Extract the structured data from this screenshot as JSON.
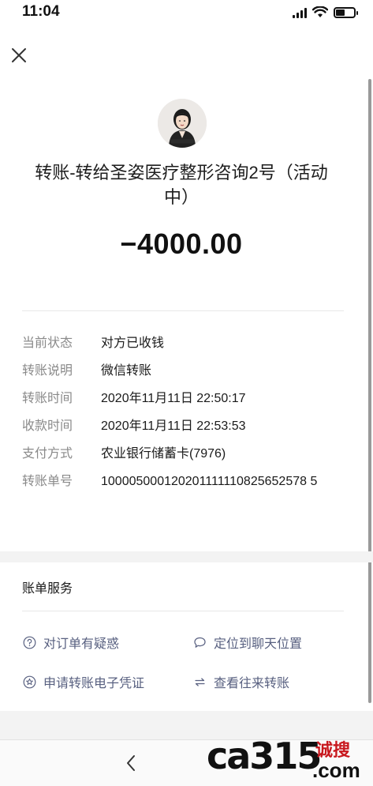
{
  "status_bar": {
    "time": "11:04"
  },
  "transfer": {
    "title": "转账-转给圣姿医疗整形咨询2号（活动中）",
    "amount": "−4000.00"
  },
  "details": [
    {
      "label": "当前状态",
      "value": "对方已收钱"
    },
    {
      "label": "转账说明",
      "value": "微信转账"
    },
    {
      "label": "转账时间",
      "value": "2020年11月11日 22:50:17"
    },
    {
      "label": "收款时间",
      "value": "2020年11月11日 22:53:53"
    },
    {
      "label": "支付方式",
      "value": "农业银行储蓄卡(7976)"
    },
    {
      "label": "转账单号",
      "value": "100005000120201111110825652578 5"
    }
  ],
  "services": {
    "title": "账单服务",
    "items": [
      {
        "label": "对订单有疑惑",
        "icon": "question-icon"
      },
      {
        "label": "定位到聊天位置",
        "icon": "chat-bubble-icon"
      },
      {
        "label": "申请转账电子凭证",
        "icon": "certificate-icon"
      },
      {
        "label": "查看往来转账",
        "icon": "exchange-arrows-icon"
      }
    ]
  },
  "watermark": {
    "logo": "ca315",
    "cn": "诚搜",
    "tld": ".com"
  },
  "colors": {
    "link": "#586080",
    "label_gray": "#8a8a8a",
    "watermark_red": "#c8181e"
  }
}
